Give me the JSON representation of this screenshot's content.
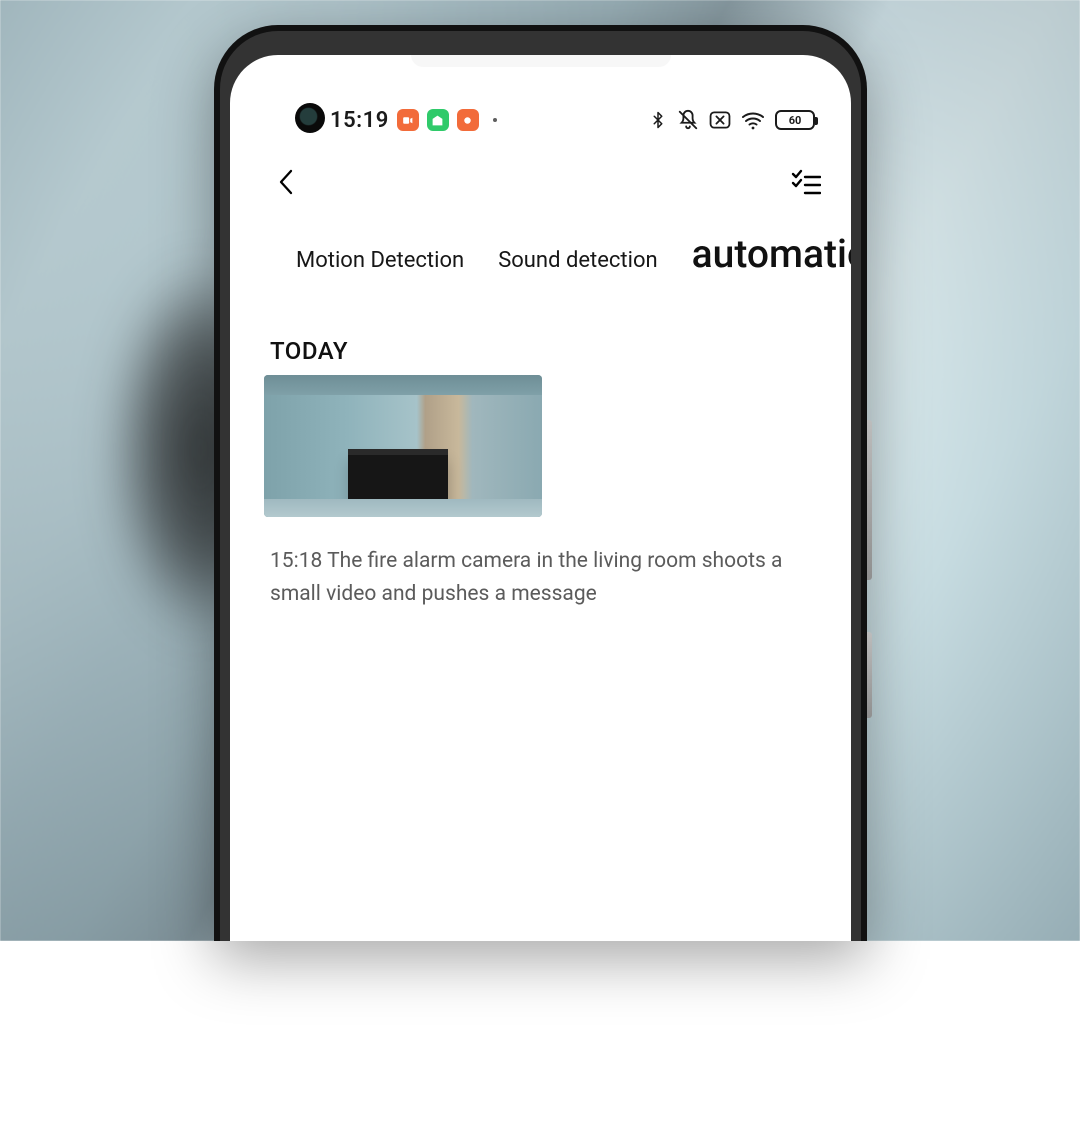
{
  "status_bar": {
    "time": "15:19",
    "battery_pct": "60"
  },
  "tabs": {
    "motion": "Motion Detection",
    "sound": "Sound detection",
    "automation": "automation"
  },
  "section": {
    "today": "TODAY"
  },
  "events": [
    {
      "caption": "15:18 The fire alarm camera in the living room shoots a small video and pushes a message"
    }
  ]
}
